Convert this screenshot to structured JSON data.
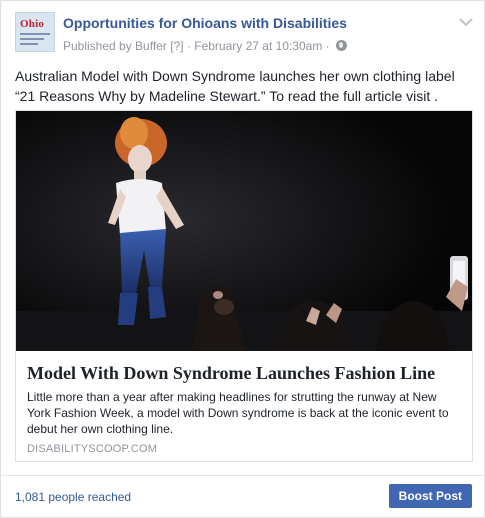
{
  "post": {
    "avatar_text": "Ohio",
    "page_name": "Opportunities for Ohioans with Disabilities",
    "published_by": "Published by Buffer",
    "info_marker": "[?]",
    "separator": "·",
    "timestamp": "February 27 at 10:30am",
    "audience_icon": "globe-icon",
    "menu_icon": "chevron-down-icon",
    "text": "Australian Model with Down Syndrome launches her own clothing label “21 Reasons Why by Madeline Stewart.” To read the full article visit ."
  },
  "link_card": {
    "title": "Model With Down Syndrome Launches Fashion Line",
    "description": "Little more than a year after making headlines for strutting the runway at New York Fashion Week, a model with Down syndrome is back at the iconic event to debut her own clothing line.",
    "domain": "DISABILITYSCOOP.COM"
  },
  "footer": {
    "reach": "1,081 people reached",
    "boost_label": "Boost Post"
  },
  "colors": {
    "link_blue": "#365899",
    "button_blue": "#4267b2",
    "meta_gray": "#90949c"
  }
}
